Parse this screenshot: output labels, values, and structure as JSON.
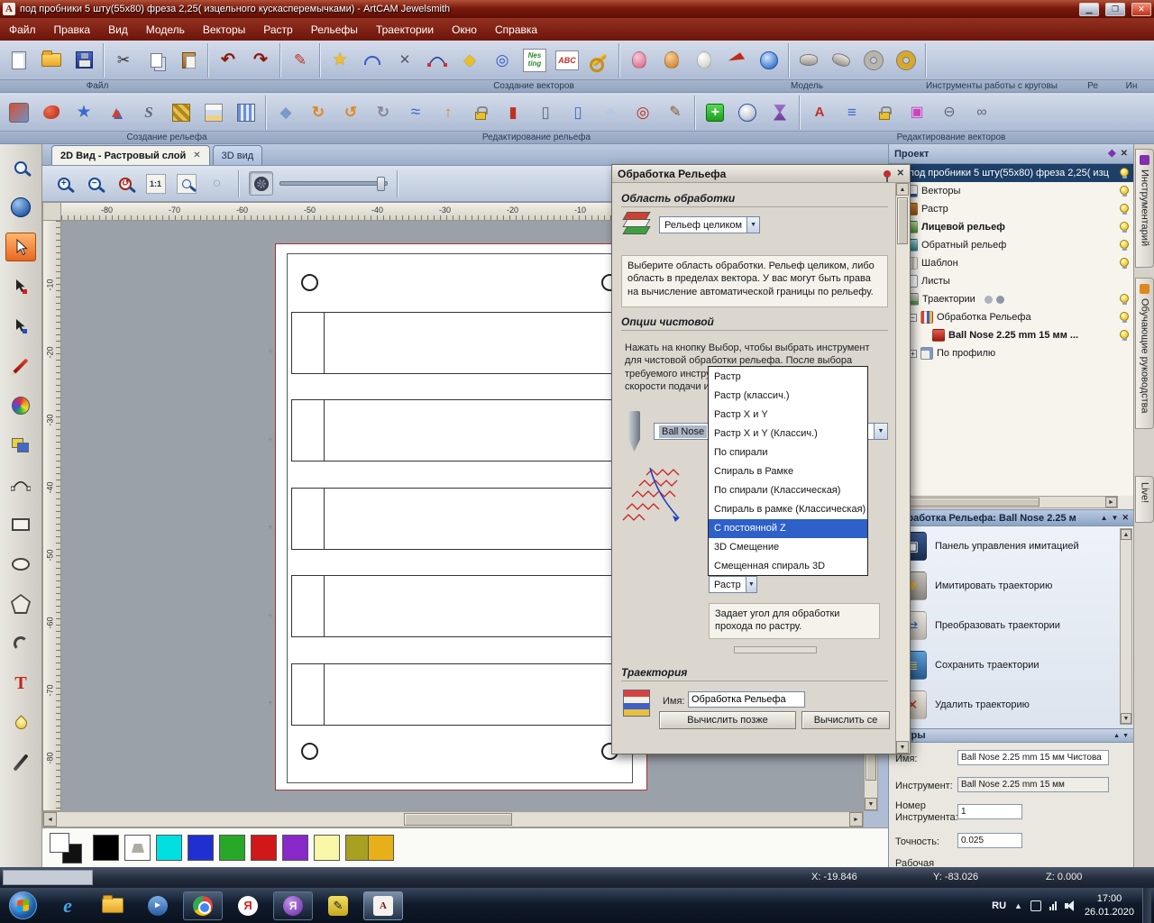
{
  "titlebar": {
    "title": "под пробники 5 шту(55x80) фреза 2,25( изцельного кускасперемычками) - ArtCAM Jewelsmith"
  },
  "menubar": {
    "items": [
      "Файл",
      "Правка",
      "Вид",
      "Модель",
      "Векторы",
      "Растр",
      "Рельефы",
      "Траектории",
      "Окно",
      "Справка"
    ]
  },
  "ribbon": {
    "row1_labels": [
      "Файл",
      "Создание векторов",
      "Модель",
      "Инструменты работы с круговы",
      "Ре",
      "Ин"
    ],
    "row2_labels": [
      "Создание рельефа",
      "Редактирование рельефа",
      "Редактирование векторов"
    ],
    "nesting_line1": "Nes",
    "nesting_line2": "ting",
    "abc_text": "ABC"
  },
  "viewbar": {
    "tab_2d": "2D Вид - Растровый слой",
    "tab_3d": "3D вид",
    "one_to_one": "1:1"
  },
  "rulers": {
    "h": [
      "-80",
      "-70",
      "-60",
      "-50",
      "-40",
      "-30",
      "-20",
      "-10"
    ],
    "v": [
      "-10",
      "-20",
      "-30",
      "-40",
      "-50",
      "-60",
      "-70",
      "-80"
    ]
  },
  "dialog": {
    "title": "Обработка Рельефа",
    "sect_area": "Область обработки",
    "area_combo": "Рельеф целиком",
    "area_help": "Выберите область обработки. Рельеф целиком, либо область в пределах вектора. У вас могут быть права на вычисление автоматической границы по рельефу.",
    "sect_finish": "Опции чистовой",
    "finish_help": "Нажать на кнопку Выбор, чтобы выбрать инструмент для чистовой обработки рельефа. После выбора требуемого инструмента задайте соответствующие скорости подачи и подачи врезания.",
    "tool_value": "Ball Nose",
    "strategy_combo": "Растр",
    "angle_help": "Задает угол для обработки прохода по растру.",
    "sect_toolpath": "Траектория",
    "name_label": "Имя:",
    "name_value": "Обработка Рельефа",
    "calc_later": "Вычислить позже",
    "calc_now": "Вычислить се"
  },
  "dropdown": {
    "options": [
      "Растр",
      "Растр (классич.)",
      "Растр X и Y",
      "Растр X и Y (Классич.)",
      "По спирали",
      "Спираль в Рамке",
      "По спирали (Классическая)",
      "Спираль в рамке (Классическая)",
      "С постоянной Z",
      "3D Смещение",
      "Смещенная спираль 3D"
    ],
    "selected": "С постоянной Z"
  },
  "project": {
    "tab": "Проект",
    "tree": [
      "под пробники 5 шту(55x80) фреза 2,25( изц",
      "Векторы",
      "Растр",
      "Лицевой рельеф",
      "Обратный рельеф",
      "Шаблон",
      "Листы",
      "Траектории",
      "Обработка Рельефа",
      "Ball Nose 2.25 mm 15 мм ...",
      "По профилю"
    ]
  },
  "simpanel": {
    "title": "Обработка Рельефа: Ball Nose 2.25 м",
    "items": [
      "Панель управления имитацией",
      "Имитировать траекторию",
      "Преобразовать траектории",
      "Сохранить траектории",
      "Удалить траекторию"
    ],
    "params_title": "метры",
    "f_name_label": "Имя:",
    "f_name_value": "Ball Nose 2.25 mm 15 мм Чистова",
    "f_tool_label": "Инструмент:",
    "f_tool_value": "Ball Nose 2.25 mm 15 мм",
    "f_num_label": "Номер Инструмента:",
    "f_num_value": "1",
    "f_tol_label": "Точность:",
    "f_tol_value": "0.025",
    "f_work_label": "Рабочая"
  },
  "rightstrip": {
    "tabs": [
      "Инструментарий",
      "Обучающие руководства",
      "Live!"
    ]
  },
  "palette": {
    "colors": [
      "#000000",
      "#ffffff",
      "#00e0e0",
      "#2030d0",
      "#28a828",
      "#d01818",
      "#8828c8",
      "#f8f8a8",
      "#a8a020",
      "#e8b018"
    ]
  },
  "statusbar": {
    "x": "X: -19.846",
    "y": "Y: -83.026",
    "z": "Z: 0.000"
  },
  "taskbar": {
    "lang": "RU",
    "time": "17:00",
    "date": "26.01.2020"
  }
}
